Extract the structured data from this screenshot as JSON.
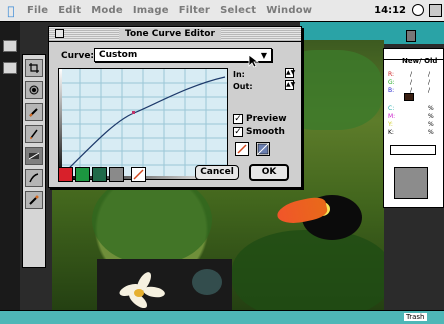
{
  "menubar": {
    "items": [
      "File",
      "Edit",
      "Mode",
      "Image",
      "Filter",
      "Select",
      "Window"
    ],
    "clock": "14:12"
  },
  "dialog": {
    "title": "Tone Curve Editor",
    "curve_label": "Curve:",
    "curve_value": "Custom",
    "in_label": "In:",
    "out_label": "Out:",
    "preview_label": "Preview",
    "smooth_label": "Smooth",
    "preview_checked": true,
    "smooth_checked": true,
    "cancel_label": "Cancel",
    "ok_label": "OK",
    "channel_colors": [
      "#d8202a",
      "#1c9640",
      "#1f6a4a",
      "#8a8a8a"
    ]
  },
  "info_palette": {
    "title": "New/ Old",
    "rows": [
      {
        "label": "R:",
        "new": "/",
        "old": "/"
      },
      {
        "label": "G:",
        "new": "/",
        "old": "/"
      },
      {
        "label": "B:",
        "new": "/",
        "old": "/"
      },
      {
        "label": "C:",
        "new": "%",
        "old": "%"
      },
      {
        "label": "M:",
        "new": "%",
        "old": "%"
      },
      {
        "label": "Y:",
        "new": "%",
        "old": "%"
      },
      {
        "label": "K:",
        "new": "%",
        "old": "%"
      }
    ]
  },
  "desktop": {
    "trash_label": "Trash"
  },
  "icons": {
    "apple": "apple-icon",
    "clock": "clock-icon",
    "app": "application-icon",
    "tools": [
      "crop-tool-icon",
      "stamp-tool-icon",
      "brush-tool-icon",
      "pen-tool-icon",
      "gradient-tool-icon",
      "smudge-tool-icon",
      "eyedropper-tool-icon"
    ]
  },
  "colors": {
    "menubar": "#e8e8e8",
    "dialog": "#cfcfcf",
    "graph_bg": "#d8ecf4",
    "curve": "#1e3a6b",
    "curve_point": "#c0336a",
    "teal": "#2aa3a6"
  }
}
